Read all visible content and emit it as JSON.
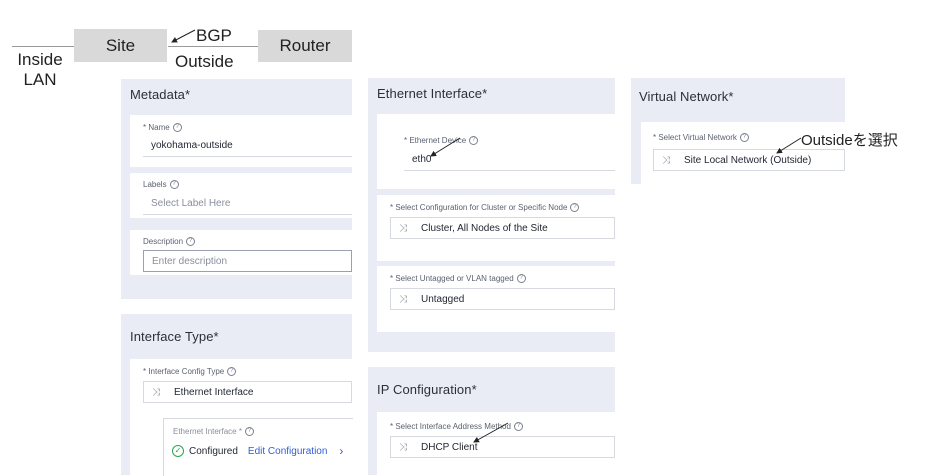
{
  "diagram": {
    "inside_lan": "Inside\nLAN",
    "site": "Site",
    "bgp": "BGP",
    "outside": "Outside",
    "router": "Router"
  },
  "metadata": {
    "title": "Metadata*",
    "name_label": "* Name",
    "name_value": "yokohama-outside",
    "labels_label": "Labels",
    "labels_placeholder": "Select Label Here",
    "description_label": "Description",
    "description_placeholder": "Enter description"
  },
  "interface_type": {
    "title": "Interface Type*",
    "config_label": "* Interface Config Type",
    "config_value": "Ethernet Interface",
    "sub_label": "Ethernet Interface *",
    "configured": "Configured",
    "edit_link": "Edit Configuration"
  },
  "ethernet": {
    "title": "Ethernet Interface*",
    "device_label": "* Ethernet Device",
    "device_value": "eth0",
    "node_label": "* Select Configuration for Cluster or Specific Node",
    "node_value": "Cluster, All Nodes of the Site",
    "vlan_label": "* Select Untagged or VLAN tagged",
    "vlan_value": "Untagged"
  },
  "ip_config": {
    "title": "IP Configuration*",
    "method_label": "* Select Interface Address Method",
    "method_value": "DHCP Client"
  },
  "virtual_network": {
    "title": "Virtual Network*",
    "select_label": "* Select Virtual Network",
    "select_value": "Site Local Network (Outside)",
    "annotation": "Outsideを選択"
  },
  "icons": {
    "help": "?",
    "select": "⤨",
    "check": "✓",
    "chevron": "›"
  },
  "colors": {
    "panel_bg": "#e9ecf5",
    "link": "#2f5fd0",
    "success": "#2da44e"
  }
}
